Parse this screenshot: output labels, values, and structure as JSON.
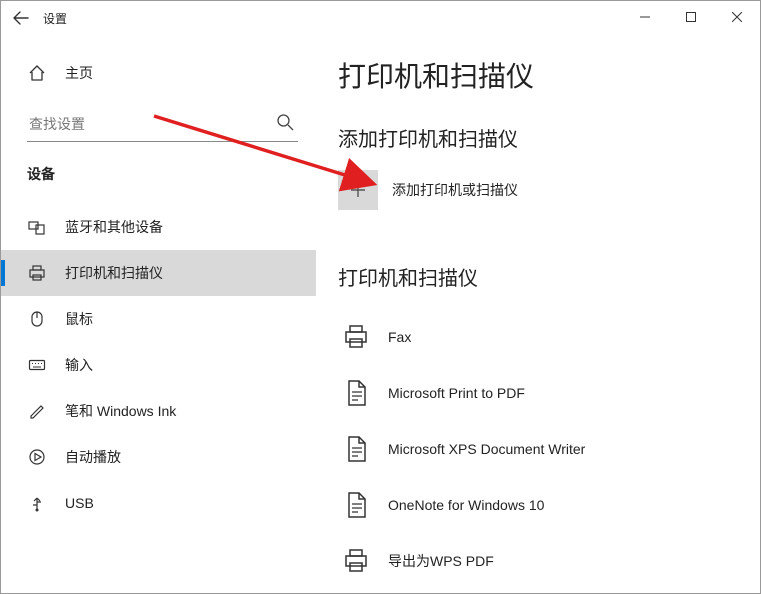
{
  "titlebar": {
    "title": "设置"
  },
  "sidebar": {
    "home_label": "主页",
    "search_placeholder": "查找设置",
    "group_title": "设备",
    "items": [
      {
        "label": "蓝牙和其他设备"
      },
      {
        "label": "打印机和扫描仪"
      },
      {
        "label": "鼠标"
      },
      {
        "label": "输入"
      },
      {
        "label": "笔和 Windows Ink"
      },
      {
        "label": "自动播放"
      },
      {
        "label": "USB"
      }
    ]
  },
  "main": {
    "page_title": "打印机和扫描仪",
    "add_section_title": "添加打印机和扫描仪",
    "add_label": "添加打印机或扫描仪",
    "list_title": "打印机和扫描仪",
    "printers": [
      {
        "name": "Fax"
      },
      {
        "name": "Microsoft Print to PDF"
      },
      {
        "name": "Microsoft XPS Document Writer"
      },
      {
        "name": "OneNote for Windows 10"
      },
      {
        "name": "导出为WPS PDF"
      }
    ]
  }
}
